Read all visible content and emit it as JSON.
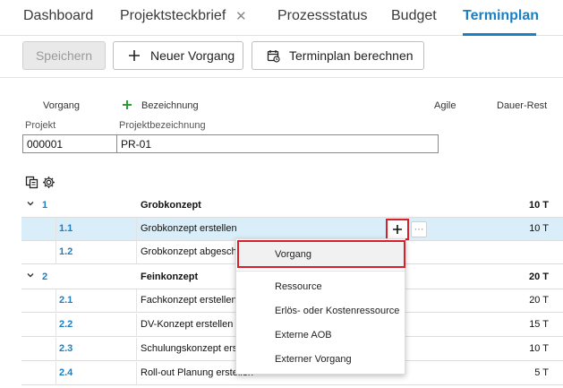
{
  "tabs": [
    {
      "label": "Dashboard"
    },
    {
      "label": "Projektsteckbrief"
    },
    {
      "label": "Prozessstatus"
    },
    {
      "label": "Budget"
    },
    {
      "label": "Terminplan"
    }
  ],
  "toolbar": {
    "save_label": "Speichern",
    "new_task_label": "Neuer Vorgang",
    "calc_label": "Terminplan berechnen"
  },
  "columns": {
    "vorgang": "Vorgang",
    "bezeichnung": "Bezeichnung",
    "agile": "Agile",
    "dauer_rest": "Dauer-Rest"
  },
  "project": {
    "projekt_label": "Projekt",
    "bezeichnung_label": "Projektbezeichnung",
    "projekt_value": "000001",
    "bezeichnung_value": "PR-01"
  },
  "rows": [
    {
      "num": "1",
      "name": "Grobkonzept",
      "dauer": "10 T"
    },
    {
      "num": "1.1",
      "name": "Grobkonzept erstellen",
      "dauer": "10 T"
    },
    {
      "num": "1.2",
      "name": "Grobkonzept abgesch",
      "dauer": ""
    },
    {
      "num": "2",
      "name": "Feinkonzept",
      "dauer": "20 T"
    },
    {
      "num": "2.1",
      "name": "Fachkonzept erstellen",
      "dauer": "20 T"
    },
    {
      "num": "2.2",
      "name": "DV-Konzept erstellen",
      "dauer": "15 T"
    },
    {
      "num": "2.3",
      "name": "Schulungskonzept ers",
      "dauer": "10 T"
    },
    {
      "num": "2.4",
      "name": "Roll-out Planung erstellen",
      "dauer": "5 T"
    }
  ],
  "row_actions": {
    "more": "···"
  },
  "menu": {
    "items": [
      {
        "label": "Vorgang"
      },
      {
        "label": "Ressource"
      },
      {
        "label": "Erlös- oder Kostenressource"
      },
      {
        "label": "Externe AOB"
      },
      {
        "label": "Externer Vorgang"
      }
    ]
  },
  "colors": {
    "accent": "#1b7fc4",
    "highlight": "#d9202a",
    "selected_row": "#d9eef8"
  }
}
